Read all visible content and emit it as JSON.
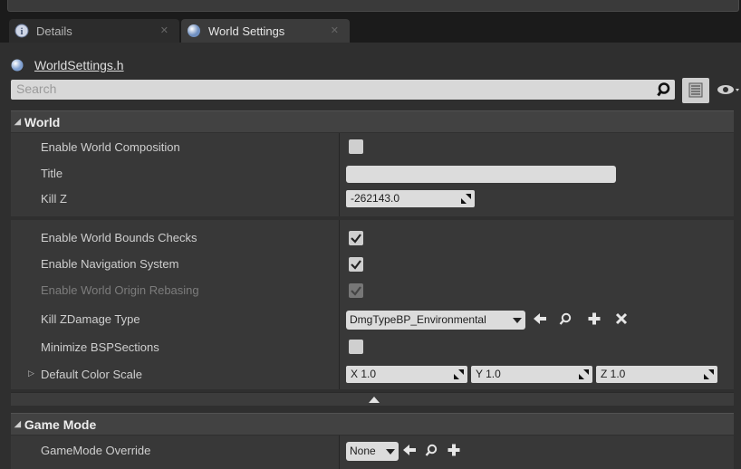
{
  "tabs": [
    {
      "label": "Details",
      "active": false
    },
    {
      "label": "World Settings",
      "active": true
    }
  ],
  "class_link": "WorldSettings.h",
  "search": {
    "placeholder": "Search",
    "value": ""
  },
  "sections": {
    "world": {
      "title": "World",
      "enable_world_composition": {
        "label": "Enable World Composition",
        "checked": false
      },
      "title_field": {
        "label": "Title",
        "value": ""
      },
      "kill_z": {
        "label": "Kill Z",
        "value": "-262143.0"
      },
      "enable_world_bounds_checks": {
        "label": "Enable World Bounds Checks",
        "checked": true
      },
      "enable_navigation_system": {
        "label": "Enable Navigation System",
        "checked": true
      },
      "enable_world_origin_rebasing": {
        "label": "Enable World Origin Rebasing",
        "checked": true,
        "disabled": true
      },
      "kill_z_damage_type": {
        "label": "Kill ZDamage Type",
        "value": "DmgTypeBP_Environmental"
      },
      "minimize_bsp_sections": {
        "label": "Minimize BSPSections",
        "checked": false
      },
      "default_color_scale": {
        "label": "Default Color Scale",
        "x": "X  1.0",
        "y": "Y  1.0",
        "z": "Z  1.0"
      }
    },
    "game_mode": {
      "title": "Game Mode",
      "gamemode_override": {
        "label": "GameMode Override",
        "value": "None"
      }
    }
  },
  "icons": {
    "details_tab": "info-icon",
    "world_tab": "globe-icon",
    "search": "search-icon",
    "view_options": "list-view-icon",
    "visibility": "eye-icon",
    "use_selected": "arrow-left-icon",
    "browse": "magnify-icon",
    "add": "plus-icon",
    "clear": "x-icon"
  },
  "colors": {
    "panel_bg": "#2f2f2f",
    "row_bg": "#383838",
    "category_bg": "#424242",
    "field_bg": "#dcdcdc"
  }
}
